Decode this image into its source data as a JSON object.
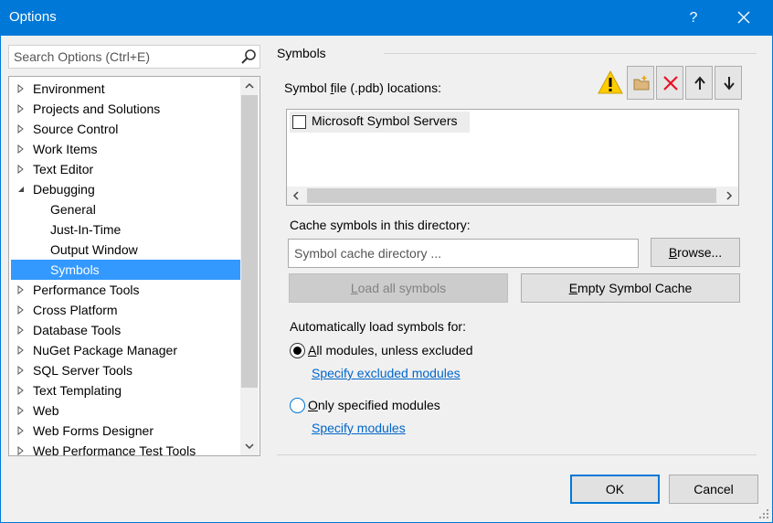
{
  "window": {
    "title": "Options",
    "help_label": "?"
  },
  "search": {
    "placeholder": "Search Options (Ctrl+E)"
  },
  "tree": {
    "items": [
      {
        "label": "Environment",
        "level": 0,
        "expander": "collapsed"
      },
      {
        "label": "Projects and Solutions",
        "level": 0,
        "expander": "collapsed"
      },
      {
        "label": "Source Control",
        "level": 0,
        "expander": "collapsed"
      },
      {
        "label": "Work Items",
        "level": 0,
        "expander": "collapsed"
      },
      {
        "label": "Text Editor",
        "level": 0,
        "expander": "collapsed"
      },
      {
        "label": "Debugging",
        "level": 0,
        "expander": "expanded"
      },
      {
        "label": "General",
        "level": 1
      },
      {
        "label": "Just-In-Time",
        "level": 1
      },
      {
        "label": "Output Window",
        "level": 1
      },
      {
        "label": "Symbols",
        "level": 1,
        "selected": true
      },
      {
        "label": "Performance Tools",
        "level": 0,
        "expander": "collapsed"
      },
      {
        "label": "Cross Platform",
        "level": 0,
        "expander": "collapsed"
      },
      {
        "label": "Database Tools",
        "level": 0,
        "expander": "collapsed"
      },
      {
        "label": "NuGet Package Manager",
        "level": 0,
        "expander": "collapsed"
      },
      {
        "label": "SQL Server Tools",
        "level": 0,
        "expander": "collapsed"
      },
      {
        "label": "Text Templating",
        "level": 0,
        "expander": "collapsed"
      },
      {
        "label": "Web",
        "level": 0,
        "expander": "collapsed"
      },
      {
        "label": "Web Forms Designer",
        "level": 0,
        "expander": "collapsed"
      },
      {
        "label": "Web Performance Test Tools",
        "level": 0,
        "expander": "collapsed"
      }
    ]
  },
  "panel": {
    "title": "Symbols",
    "locations_label_pre": "Symbol ",
    "locations_label_key": "f",
    "locations_label_post": "ile (.pdb) locations:",
    "toolbar_icons": [
      "warning-icon",
      "new-folder-icon",
      "delete-icon",
      "move-up-icon",
      "move-down-icon"
    ],
    "locations": [
      {
        "label": "Microsoft Symbol Servers",
        "checked": false
      }
    ],
    "cache_label": "Cache symbols in this directory:",
    "cache_placeholder": "Symbol cache directory ...",
    "browse_pre": "",
    "browse_key": "B",
    "browse_post": "rowse...",
    "load_all_pre": "",
    "load_all_key": "L",
    "load_all_post": "oad all symbols",
    "empty_cache_pre": "",
    "empty_cache_key": "E",
    "empty_cache_post": "mpty Symbol Cache",
    "auto_label": "Automatically load symbols for:",
    "radio_all_key": "A",
    "radio_all_post": "ll modules, unless excluded",
    "radio_all_selected": true,
    "link_excluded": "Specify excluded modules",
    "radio_only_key": "O",
    "radio_only_post": "nly specified modules",
    "radio_only_selected": false,
    "link_modules": "Specify modules"
  },
  "footer": {
    "ok_label": "OK",
    "cancel_label": "Cancel"
  },
  "colors": {
    "accent": "#0078d7",
    "selection": "#3399ff",
    "link": "#0066cc",
    "warning": "#ffcc00",
    "delete": "#e81123"
  }
}
